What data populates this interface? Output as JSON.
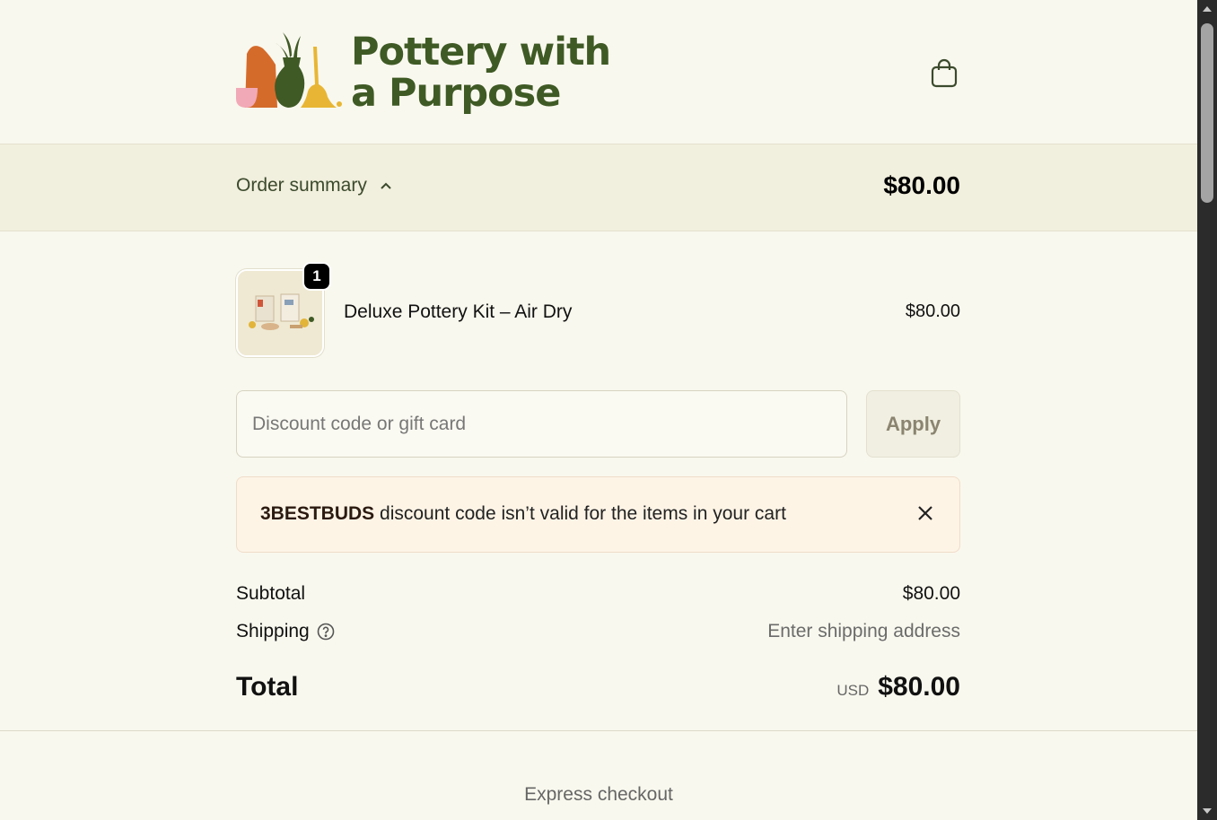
{
  "header": {
    "logo_text_line1": "Pottery with",
    "logo_text_line2": "a Purpose",
    "logo_icon": "pottery-vases-logo",
    "cart_icon": "shopping-bag-icon"
  },
  "summary": {
    "toggle_label": "Order summary",
    "toggle_icon": "chevron-up-icon",
    "total": "$80.00"
  },
  "line_item": {
    "quantity": "1",
    "name": "Deluxe Pottery Kit – Air Dry",
    "price": "$80.00"
  },
  "discount": {
    "placeholder": "Discount code or gift card",
    "apply_label": "Apply"
  },
  "alert": {
    "code": "3BESTBUDS",
    "message": " discount code isn’t valid for the items in your cart",
    "close_icon": "close-icon"
  },
  "totals": {
    "subtotal_label": "Subtotal",
    "subtotal_value": "$80.00",
    "shipping_label": "Shipping",
    "shipping_help_icon": "help-circle-icon",
    "shipping_value": "Enter shipping address",
    "total_label": "Total",
    "currency": "USD",
    "total_value": "$80.00"
  },
  "express": {
    "label": "Express checkout"
  },
  "colors": {
    "background": "#f9f8ee",
    "brand_green": "#3f5a25",
    "summary_bar": "#f1efdd",
    "alert_bg": "#fdf4e6"
  }
}
